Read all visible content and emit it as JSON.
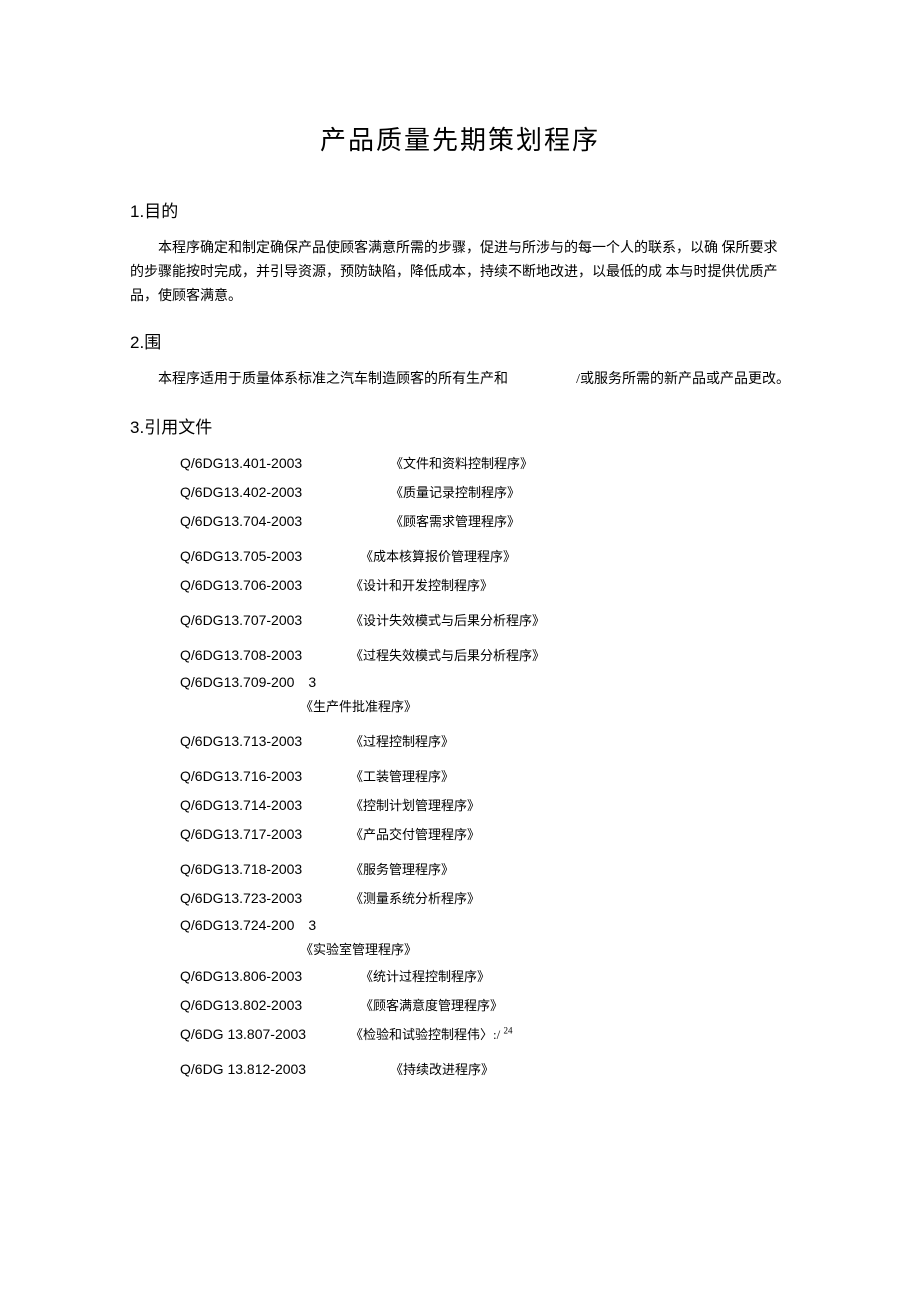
{
  "title": "产品质量先期策划程序",
  "s1": {
    "num": "1",
    "heading": ".目的",
    "para": "本程序确定和制定确保产品使顾客满意所需的步骤，促进与所涉与的每一个人的联系，以确 保所要求的步骤能按时完成，并引导资源，预防缺陷，降低成本，持续不断地改进，以最低的成 本与时提供优质产品，使顾客满意。"
  },
  "s2": {
    "num": "2",
    "heading": ".围",
    "left": "本程序适用于质量体系标准之汽车制造顾客的所有生产和",
    "right": "/或服务所需的新产品或产品更改。"
  },
  "s3": {
    "num": "3",
    "heading": ".引用文件",
    "refs": {
      "r1": {
        "code": "Q/6DG13.401-2003",
        "name": "《文件和资料控制程序》"
      },
      "r2": {
        "code": "Q/6DG13.402-2003",
        "name": "《质量记录控制程序》"
      },
      "r3": {
        "code": "Q/6DG13.704-2003",
        "name": "《顾客需求管理程序》"
      },
      "r4": {
        "code": "Q/6DG13.705-2003",
        "name": "《成本核算报价管理程序》"
      },
      "r5": {
        "code": "Q/6DG13.706-2003",
        "name": "《设计和开发控制程序》"
      },
      "r6": {
        "code": "Q/6DG13.707-2003",
        "name": "《设计失效模式与后果分析程序》"
      },
      "r7": {
        "code": "Q/6DG13.708-2003",
        "name": "《过程失效模式与后果分析程序》"
      },
      "r8": {
        "code_a": "Q/6DG13.709-200",
        "code_b": "3",
        "name": "《生产件批准程序》"
      },
      "r9": {
        "code": "Q/6DG13.713-2003",
        "name": "《过程控制程序》"
      },
      "r10": {
        "code": "Q/6DG13.716-2003",
        "name": "《工装管理程序》"
      },
      "r11": {
        "code": "Q/6DG13.714-2003",
        "name": "《控制计划管理程序》"
      },
      "r12": {
        "code": "Q/6DG13.717-2003",
        "name": "《产品交付管理程序》"
      },
      "r13": {
        "code": "Q/6DG13.718-2003",
        "name": "《服务管理程序》"
      },
      "r14": {
        "code": "Q/6DG13.723-2003",
        "name": "《测量系统分析程序》"
      },
      "r15": {
        "code_a": "Q/6DG13.724-200",
        "code_b": "3",
        "name": "《实验室管理程序》"
      },
      "r16": {
        "code": "Q/6DG13.806-2003",
        "name": "《统计过程控制程序》"
      },
      "r17": {
        "code": "Q/6DG13.802-2003",
        "name": "《顾客满意度管理程序》"
      },
      "r18": {
        "code": "Q/6DG 13.807-2003",
        "name_a": "《检验和试验控制程伟〉:/ ",
        "name_sup": "24"
      },
      "r19": {
        "code": "Q/6DG 13.812-2003",
        "name": "《持续改进程序》"
      }
    }
  }
}
